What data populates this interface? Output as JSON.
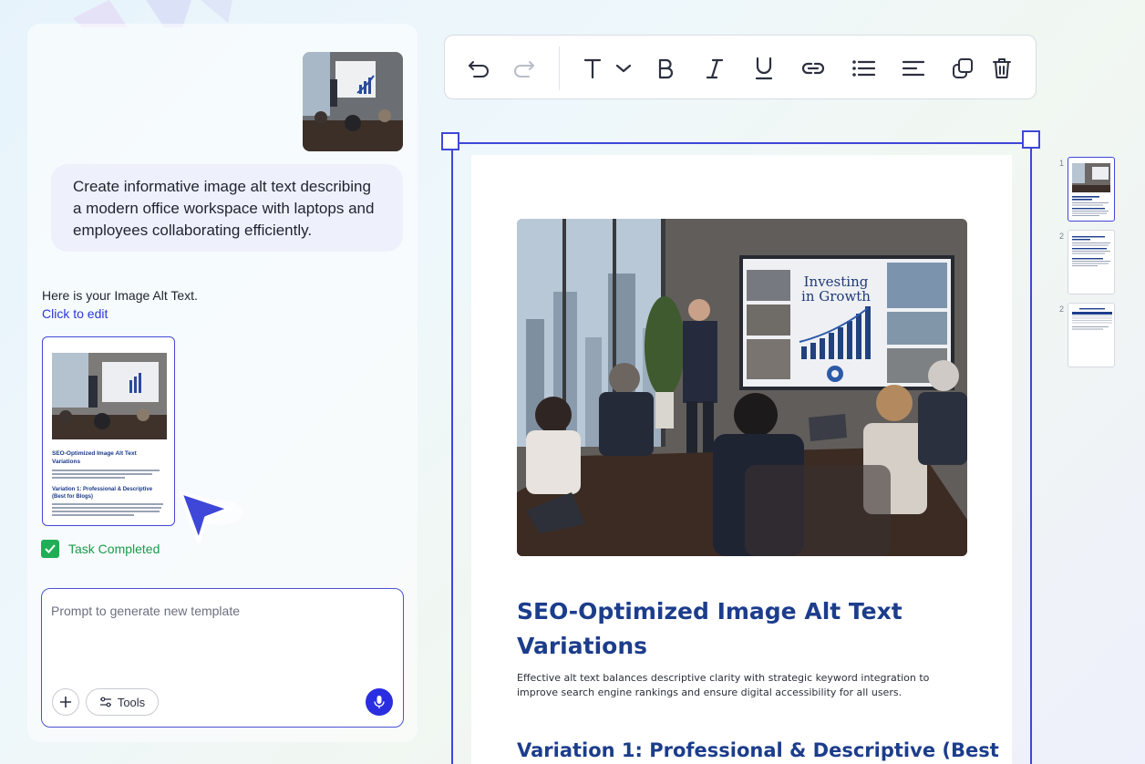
{
  "chat": {
    "user_message": "Create informative image alt text describing a modern office workspace with laptops and employees collaborating efficiently.",
    "reply_text": "Here is your Image Alt Text.",
    "reply_link": "Click to edit",
    "thumb": {
      "title": "SEO-Optimized Image Alt Text Variations",
      "subtitle": "Variation 1: Professional & Descriptive (Best for Blogs)"
    },
    "task_status": "Task Completed"
  },
  "prompt": {
    "placeholder": "Prompt to generate new template",
    "tools_label": "Tools"
  },
  "toolbar": {
    "icons": [
      "undo-icon",
      "redo-icon",
      "text-type-icon",
      "chevron-down-icon",
      "bold-icon",
      "italic-icon",
      "underline-icon",
      "link-icon",
      "list-icon",
      "align-icon",
      "duplicate-icon",
      "delete-icon"
    ]
  },
  "document": {
    "image_text": "Investing in Growth",
    "title": "SEO-Optimized Image Alt Text Variations",
    "paragraph": "Effective alt text balances descriptive clarity with strategic keyword integration to improve search engine rankings and ensure digital accessibility for all users.",
    "heading2": "Variation 1: Professional & Descriptive (Best"
  },
  "pages": {
    "numbers": [
      "1",
      "2",
      "2"
    ]
  },
  "colors": {
    "accent": "#3e47d8",
    "heading": "#1c3d8c",
    "success": "#1fae55",
    "mic": "#2a2ee0"
  }
}
